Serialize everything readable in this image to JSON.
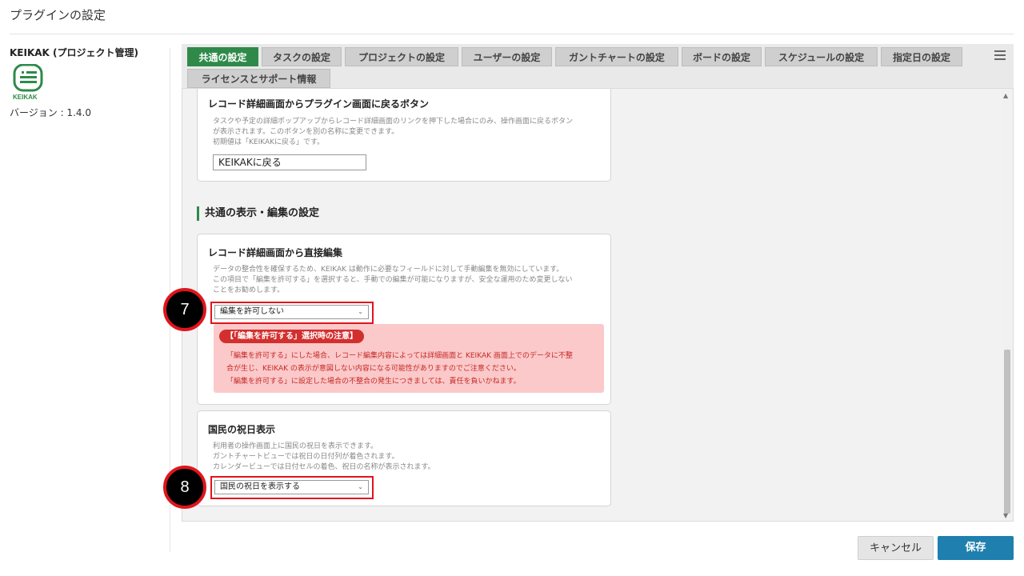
{
  "page": {
    "title": "プラグインの設定"
  },
  "plugin": {
    "name": "KEIKAK (プロジェクト管理)",
    "logo_text": "KEIKAK",
    "version": "バージョン : 1.4.0"
  },
  "tabs": [
    {
      "label": "共通の設定",
      "active": true
    },
    {
      "label": "タスクの設定"
    },
    {
      "label": "プロジェクトの設定"
    },
    {
      "label": "ユーザーの設定"
    },
    {
      "label": "ガントチャートの設定"
    },
    {
      "label": "ボードの設定"
    },
    {
      "label": "スケジュールの設定"
    },
    {
      "label": "指定日の設定"
    },
    {
      "label": "ライセンスとサポート情報"
    }
  ],
  "cards": {
    "back_button": {
      "title": "レコード詳細画面からプラグイン画面に戻るボタン",
      "desc": [
        "タスクや予定の詳細ポップアップからレコード詳細画面のリンクを押下した場合にのみ、操作画面に戻るボタン",
        "が表示されます。このボタンを別の名称に変更できます。",
        "初期値は「KEIKAKに戻る」です。"
      ],
      "input_value": "KEIKAKに戻る"
    },
    "section_heading": "共通の表示・編集の設定",
    "direct_edit": {
      "title": "レコード詳細画面から直接編集",
      "desc": [
        "データの整合性を確保するため、KEIKAK は動作に必要なフィールドに対して手動編集を無効にしています。",
        "この項目で「編集を許可する」を選択すると、手動での編集が可能になりますが、安全な運用のため変更しない",
        "ことをお勧めします。"
      ],
      "select_value": "編集を許可しない",
      "warning_title": "【「編集を許可する」選択時の注意】",
      "warning_lines": [
        "「編集を許可する」にした場合、レコード編集内容によっては詳細画面と KEIKAK 画面上でのデータに不整",
        "合が生じ、KEIKAK の表示が意図しない内容になる可能性がありますのでご注意ください。",
        "「編集を許可する」に設定した場合の不整合の発生につきましては、責任を負いかねます。"
      ]
    },
    "holiday": {
      "title": "国民の祝日表示",
      "desc": [
        "利用者の操作画面上に国民の祝日を表示できます。",
        "ガントチャートビューでは祝日の日付列が着色されます。",
        "カレンダービューでは日付セルの着色、祝日の名称が表示されます。"
      ],
      "select_value": "国民の祝日を表示する"
    }
  },
  "badges": {
    "step7": "7",
    "step8": "8"
  },
  "buttons": {
    "cancel": "キャンセル",
    "save": "保存"
  },
  "colors": {
    "accent_green": "#2f8a4a",
    "save_blue": "#1f7fae",
    "annotation_red": "#e0151c"
  }
}
